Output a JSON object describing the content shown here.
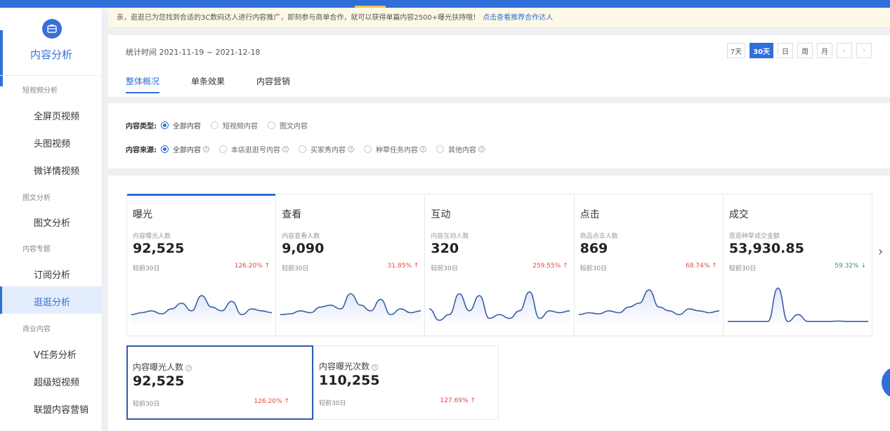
{
  "notice": {
    "text": "亲，逛逛已为您找到合适的3C数码达人进行内容推广，即刻参与商单合作，就可以获得单篇内容2500+曝光扶持哦！",
    "link": "点击查看推荐合作达人"
  },
  "sidebar": {
    "title": "内容分析",
    "groups": {
      "short_video": "短视频分析",
      "image_text": "图文分析",
      "topic": "内容专题",
      "business": "商业内容"
    },
    "items": {
      "fullscreen": "全屏页视频",
      "head": "头图视频",
      "detail": "微详情视频",
      "image_text": "图文分析",
      "subscribe": "订阅分析",
      "guangguang": "逛逛分析",
      "vtask": "V任务分析",
      "super_video": "超级短视频",
      "alliance": "联盟内容营销"
    },
    "active": "逛逛分析"
  },
  "header": {
    "stat_time": "统计时间 2021-11-19 ~ 2021-12-18",
    "ranges": [
      "7天",
      "30天",
      "日",
      "周",
      "月"
    ],
    "active_range": "30天",
    "nav_prev": "‹",
    "nav_next": "›",
    "tabs": [
      "整体概况",
      "单条效果",
      "内容营销"
    ],
    "active_tab": "整体概况"
  },
  "filters": {
    "type_label": "内容类型:",
    "type_options": [
      "全部内容",
      "短视频内容",
      "图文内容"
    ],
    "source_label": "内容来源:",
    "source_options": [
      "全部内容",
      "本店逛逛号内容",
      "买家秀内容",
      "种草任务内容",
      "其他内容"
    ],
    "help_glyph": "?"
  },
  "metrics": [
    {
      "title": "曝光",
      "sub": "内容曝光人数",
      "value": "92,525",
      "compare": "较前30日",
      "pct": "126.20%",
      "trend": "up",
      "spark": [
        0.2,
        0.25,
        0.3,
        0.22,
        0.35,
        0.5,
        0.3,
        0.7,
        0.4,
        0.3,
        0.55,
        0.2,
        0.35,
        0.3,
        0.25
      ]
    },
    {
      "title": "查看",
      "sub": "内容查看人数",
      "value": "9,090",
      "compare": "较前30日",
      "pct": "31.85%",
      "trend": "up",
      "spark": [
        0.2,
        0.22,
        0.3,
        0.25,
        0.4,
        0.45,
        0.35,
        0.75,
        0.45,
        0.3,
        0.6,
        0.2,
        0.35,
        0.25,
        0.3
      ]
    },
    {
      "title": "互动",
      "sub": "内容互动人数",
      "value": "320",
      "compare": "较前30日",
      "pct": "259.55%",
      "trend": "up",
      "spark": [
        0.35,
        0.05,
        0.2,
        0.75,
        0.3,
        0.7,
        0.1,
        0.2,
        0.1,
        0.3,
        0.8,
        0.1,
        0.3,
        0.25,
        0.3
      ]
    },
    {
      "title": "点击",
      "sub": "商品点击人数",
      "value": "869",
      "compare": "较前30日",
      "pct": "68.74%",
      "trend": "up",
      "spark": [
        0.2,
        0.25,
        0.22,
        0.3,
        0.25,
        0.4,
        0.5,
        0.85,
        0.4,
        0.3,
        0.2,
        0.35,
        0.3,
        0.25,
        0.3
      ]
    },
    {
      "title": "成交",
      "sub": "逛逛种草成交金额",
      "value": "53,930.85",
      "compare": "较前30日",
      "pct": "59.32%",
      "trend": "down",
      "spark": [
        0.02,
        0.02,
        0.02,
        0.02,
        0.02,
        0.9,
        0.02,
        0.2,
        0.02,
        0.02,
        0.02,
        0.03,
        0.02,
        0.02,
        0.02
      ]
    }
  ],
  "trend_glyph": {
    "up": "↑",
    "down": "↓"
  },
  "next_glyph": "›",
  "sub_metrics": [
    {
      "title": "内容曝光人数",
      "value": "92,525",
      "compare": "较前30日",
      "pct": "126.20%"
    },
    {
      "title": "内容曝光次数",
      "value": "110,255",
      "compare": "较前30日",
      "pct": "127.69%"
    }
  ],
  "colors": {
    "accent": "#2f6fd8",
    "up": "#e04a3c",
    "down": "#2a9c5a",
    "spark": "#3a5ea8"
  }
}
